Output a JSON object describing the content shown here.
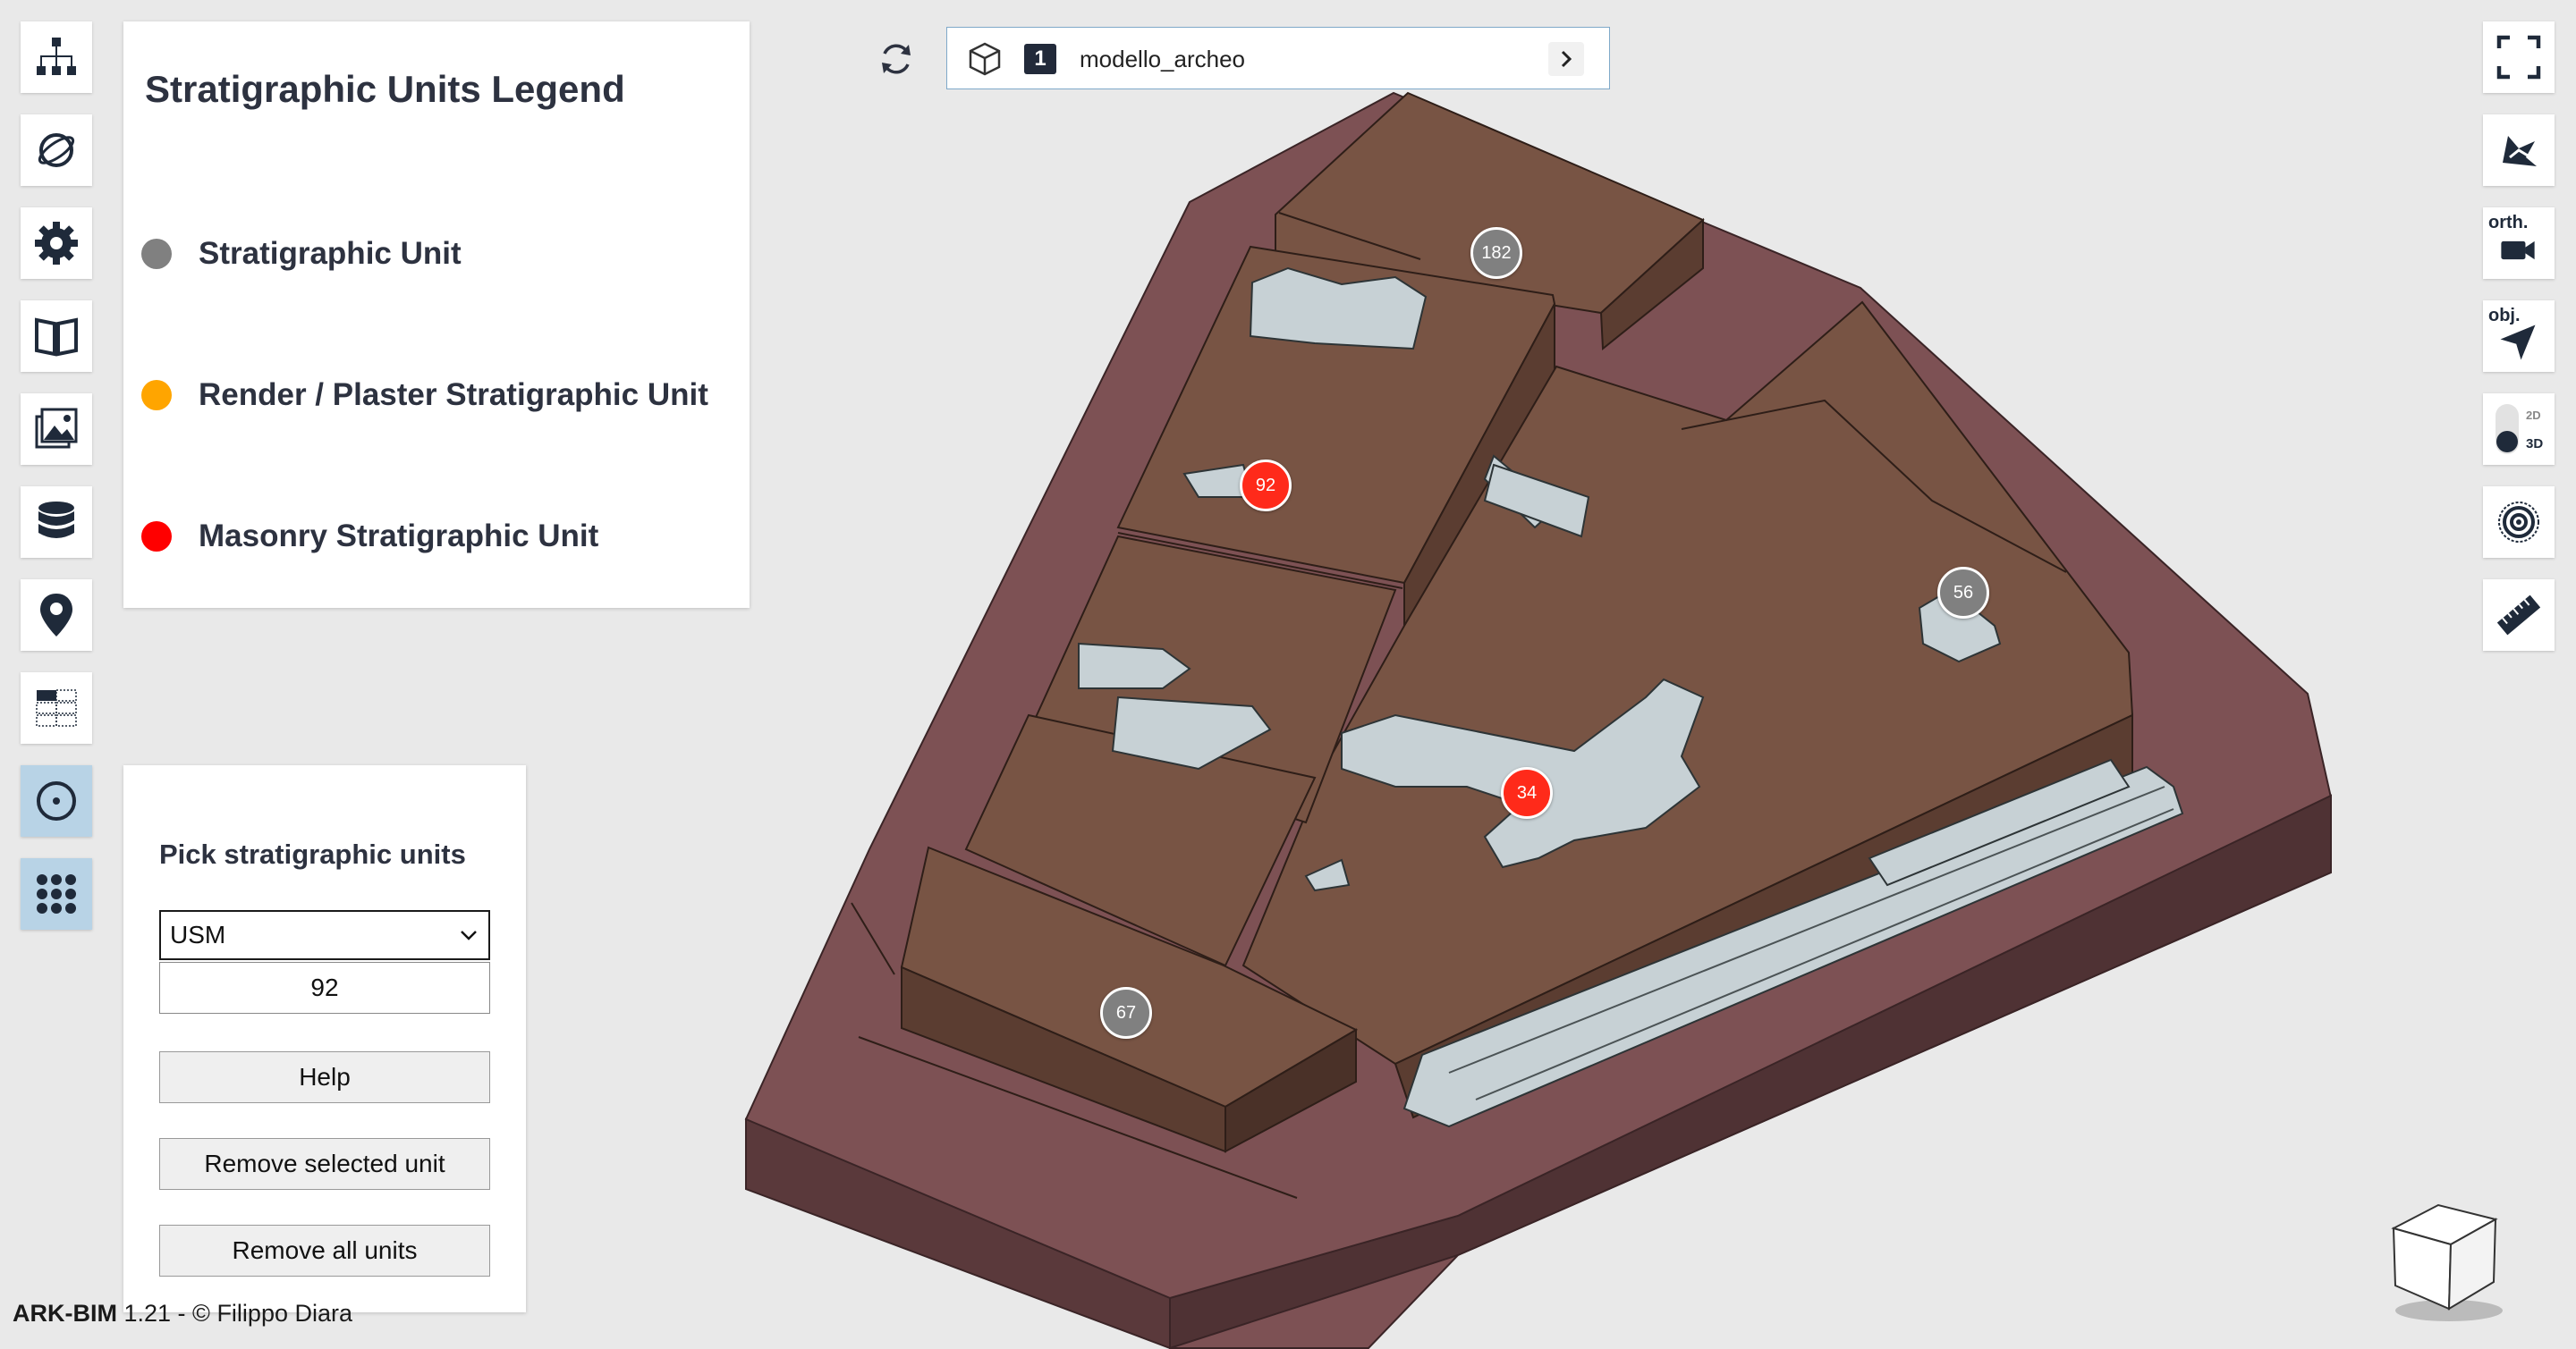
{
  "app": {
    "name": "ARK-BIM",
    "version": "1.21 - © Filippo Diara"
  },
  "left_toolbar": [
    {
      "id": "hierarchy",
      "icon": "hierarchy-tree-icon"
    },
    {
      "id": "globe",
      "icon": "globe-orbit-icon"
    },
    {
      "id": "settings",
      "icon": "gear-icon"
    },
    {
      "id": "documentation",
      "icon": "open-book-icon"
    },
    {
      "id": "images",
      "icon": "image-gallery-icon"
    },
    {
      "id": "database",
      "icon": "database-icon"
    },
    {
      "id": "location",
      "icon": "location-pin-icon"
    },
    {
      "id": "matrix",
      "icon": "harris-matrix-icon"
    },
    {
      "id": "pick-units",
      "icon": "target-circle-icon",
      "active": true
    },
    {
      "id": "apps",
      "icon": "grid-dots-icon",
      "active": true
    }
  ],
  "right_toolbar": {
    "fullscreen": {
      "icon": "fullscreen-icon"
    },
    "navigation": {
      "icon": "navigation-arrows-icon"
    },
    "camera": {
      "label": "orth.",
      "icon": "video-camera-icon"
    },
    "object": {
      "label": "obj.",
      "icon": "cursor-arrow-icon"
    },
    "toggle": {
      "label_2d": "2D",
      "label_3d": "3D",
      "active": "3D"
    },
    "section": {
      "icon": "concentric-circles-icon"
    },
    "measure": {
      "icon": "ruler-icon"
    }
  },
  "legend": {
    "title": "Stratigraphic Units Legend",
    "items": [
      {
        "label": "Stratigraphic Unit",
        "color": "#808080"
      },
      {
        "label": "Render / Plaster Stratigraphic Unit",
        "color": "#ffa500"
      },
      {
        "label": "Masonry Stratigraphic Unit",
        "color": "#ff0000"
      }
    ]
  },
  "pick_panel": {
    "title": "Pick stratigraphic units",
    "select_value": "USM",
    "input_value": "92",
    "buttons": {
      "help": "Help",
      "remove_selected": "Remove selected unit",
      "remove_all": "Remove all units"
    }
  },
  "model_bar": {
    "count": "1",
    "name": "modello_archeo"
  },
  "markers": [
    {
      "label": "182",
      "color": "#808080"
    },
    {
      "label": "92",
      "color": "#ff2a1a"
    },
    {
      "label": "56",
      "color": "#808080"
    },
    {
      "label": "34",
      "color": "#ff2a1a"
    },
    {
      "label": "67",
      "color": "#808080"
    }
  ],
  "colors": {
    "site_base": "#7d5154",
    "walls": "#785444",
    "masonry_blocks": "#c7d1d5",
    "active_button": "#b8d3e6"
  }
}
